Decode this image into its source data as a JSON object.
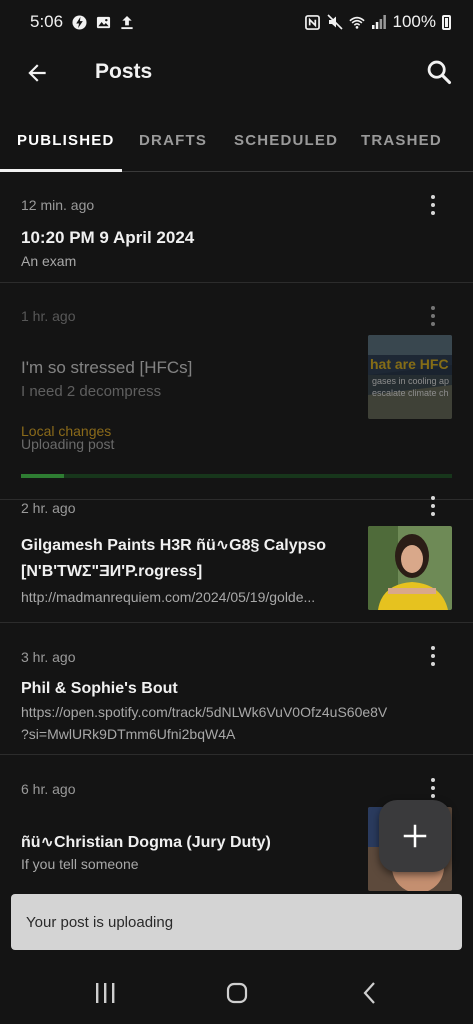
{
  "status_bar": {
    "time": "5:06",
    "battery_text": "100%"
  },
  "header": {
    "title": "Posts",
    "back_icon": "arrow-left-icon",
    "search_icon": "search-icon"
  },
  "tabs": [
    {
      "label": "PUBLISHED",
      "active": true
    },
    {
      "label": "DRAFTS",
      "active": false
    },
    {
      "label": "SCHEDULED",
      "active": false
    },
    {
      "label": "TRASHED",
      "active": false
    }
  ],
  "posts": [
    {
      "time": "12 min. ago",
      "title": "10:20 PM 9 April 2024",
      "excerpt": "An exam"
    },
    {
      "time": "1 hr. ago",
      "title": "I'm so stressed [HFCs]",
      "excerpt": "I need 2 decompress",
      "status_local": "Local changes",
      "status_upload": "Uploading post",
      "upload_progress_percent": 10,
      "thumb_text_1": "hat are HFC",
      "thumb_text_2": "gases in cooling ap",
      "thumb_text_3": "escalate climate ch"
    },
    {
      "time": "2 hr. ago",
      "title": "Gilgamesh Paints H3R ñü∿G8§ Calypso",
      "title_line2": "[N'B'TWΣ\"ƎИ'P.rogress]",
      "excerpt": "http://madmanrequiem.com/2024/05/19/golde..."
    },
    {
      "time": "3 hr. ago",
      "title": "Phil & Sophie's Bout",
      "excerpt": "https://open.spotify.com/track/5dNLWk6VuV0Ofz4uS60e8V",
      "excerpt_line2": "?si=MwlURk9DTmm6Ufni2bqW4A"
    },
    {
      "time": "6 hr. ago",
      "title": "ñü∿Christian Dogma (Jury Duty)",
      "excerpt": "If you tell someone"
    }
  ],
  "fab": {
    "icon": "plus-icon"
  },
  "snackbar": {
    "message": "Your post is uploading"
  },
  "colors": {
    "background": "#141414",
    "progress": "#2e7d32",
    "snackbar_bg": "#d4d4d4"
  }
}
